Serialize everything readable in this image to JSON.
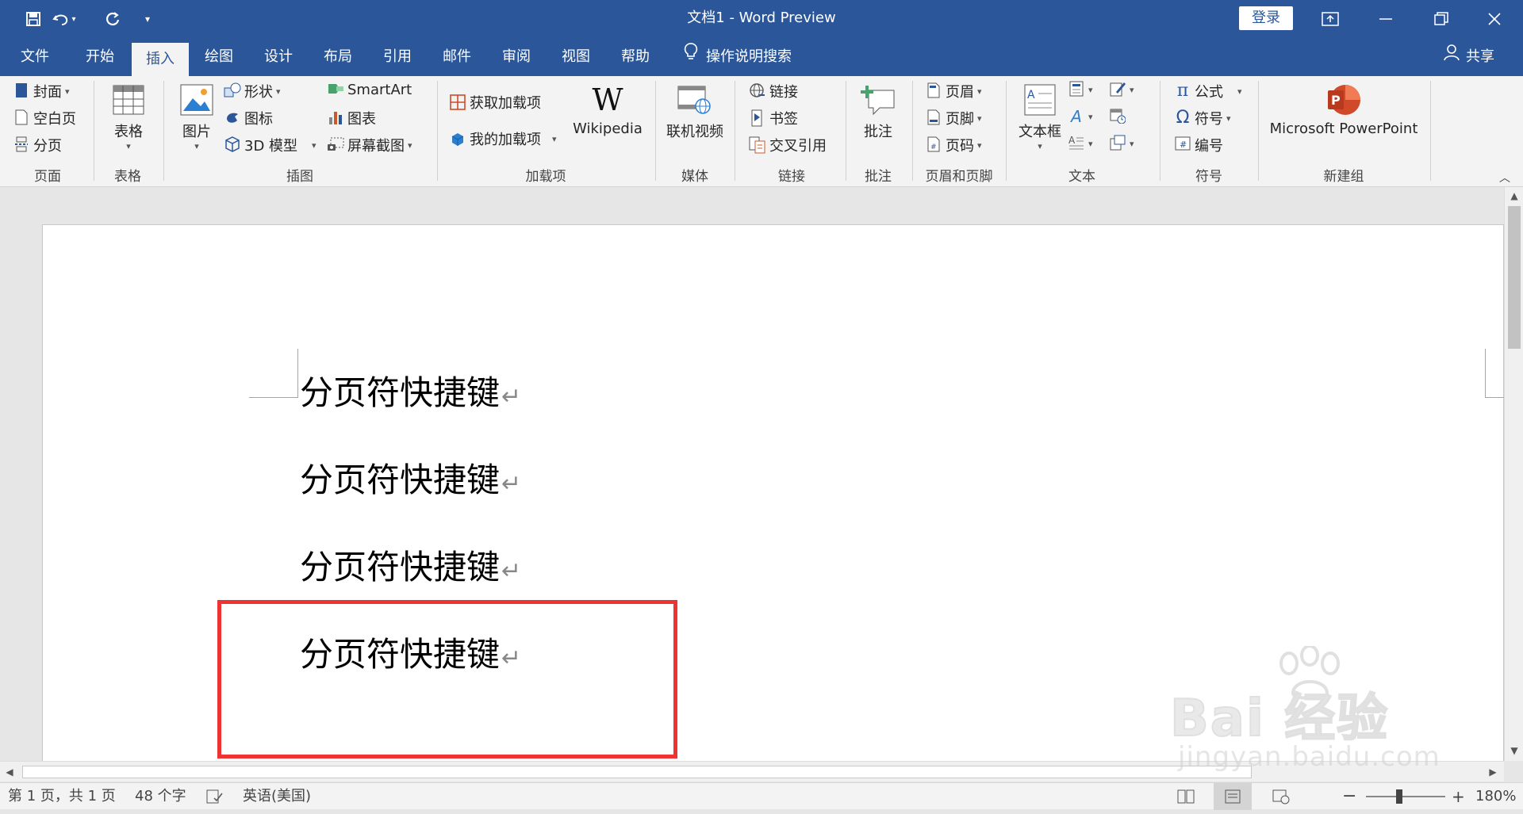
{
  "window": {
    "title": "文档1  -  Word Preview",
    "login_label": "登录"
  },
  "tabs": [
    {
      "label": "文件"
    },
    {
      "label": "开始"
    },
    {
      "label": "插入",
      "active": true
    },
    {
      "label": "绘图"
    },
    {
      "label": "设计"
    },
    {
      "label": "布局"
    },
    {
      "label": "引用"
    },
    {
      "label": "邮件"
    },
    {
      "label": "审阅"
    },
    {
      "label": "视图"
    },
    {
      "label": "帮助"
    }
  ],
  "tell_me": "操作说明搜索",
  "share": "共享",
  "ribbon": {
    "pages": {
      "cover": "封面",
      "blank": "空白页",
      "break": "分页",
      "group": "页面"
    },
    "tables": {
      "table": "表格",
      "group": "表格"
    },
    "illustrations": {
      "pictures": "图片",
      "shapes": "形状",
      "icons": "图标",
      "models3d": "3D 模型",
      "smartart": "SmartArt",
      "chart": "图表",
      "screenshot": "屏幕截图",
      "group": "插图"
    },
    "addins": {
      "get": "获取加载项",
      "my": "我的加载项",
      "wikipedia": "Wikipedia",
      "group": "加载项"
    },
    "media": {
      "video": "联机视频",
      "group": "媒体"
    },
    "links": {
      "link": "链接",
      "bookmark": "书签",
      "crossref": "交叉引用",
      "group": "链接"
    },
    "comments": {
      "comment": "批注",
      "group": "批注"
    },
    "headerfooter": {
      "header": "页眉",
      "footer": "页脚",
      "pagenum": "页码",
      "group": "页眉和页脚"
    },
    "text": {
      "textbox": "文本框",
      "group": "文本"
    },
    "symbols": {
      "equation": "公式",
      "symbol": "符号",
      "number": "编号",
      "group": "符号"
    },
    "newgroup": {
      "ppt": "Microsoft PowerPoint",
      "group": "新建组"
    }
  },
  "document": {
    "paragraphs": [
      "分页符快捷键",
      "分页符快捷键",
      "分页符快捷键",
      "分页符快捷键"
    ]
  },
  "status": {
    "page": "第 1 页，共 1 页",
    "words": "48 个字",
    "language": "英语(美国)",
    "zoom": "180%"
  },
  "watermark": {
    "text": "Bai 经验",
    "sub": "jingyan.baidu.com"
  },
  "colors": {
    "brand": "#2b579a",
    "highlight": "#ee3333"
  }
}
